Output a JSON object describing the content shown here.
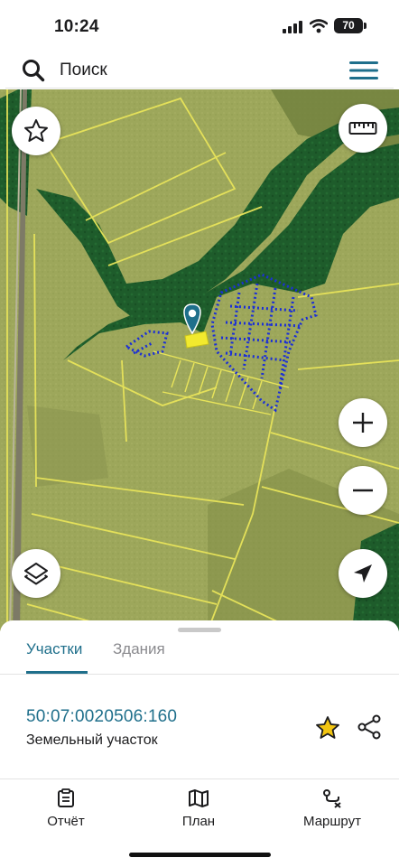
{
  "status_bar": {
    "time": "10:24",
    "battery": "70",
    "icons": [
      "cellular-signal-icon",
      "wifi-icon",
      "battery-icon"
    ]
  },
  "search": {
    "placeholder": "Поиск",
    "search_icon": "search-icon",
    "menu_icon": "menu-icon"
  },
  "map": {
    "pin_icon": "map-pin-icon",
    "controls": {
      "favorite": "star-icon",
      "ruler": "ruler-icon",
      "zoom_in": "plus-icon",
      "zoom_out": "minus-icon",
      "layers": "layers-icon",
      "locate": "navigation-arrow-icon"
    },
    "colors": {
      "field": "#9aa457",
      "forest": "#1f5f2c",
      "parcel_border": "#e8e45a",
      "selected_parcel": "#f2ea2e",
      "dotted_parcels": "#1b2fd6",
      "pin": "#1f6f8b"
    }
  },
  "sheet": {
    "tabs": [
      {
        "label": "Участки",
        "active": true
      },
      {
        "label": "Здания",
        "active": false
      }
    ],
    "parcel": {
      "number": "50:07:0020506:160",
      "type": "Земельный участок",
      "favorite_icon": "star-icon",
      "share_icon": "share-icon"
    },
    "nav": [
      {
        "label": "Отчёт",
        "icon": "report-icon"
      },
      {
        "label": "План",
        "icon": "map-plan-icon"
      },
      {
        "label": "Маршрут",
        "icon": "route-icon"
      }
    ]
  },
  "accent_color": "#1f6f8b",
  "star_color": "#f2c511"
}
